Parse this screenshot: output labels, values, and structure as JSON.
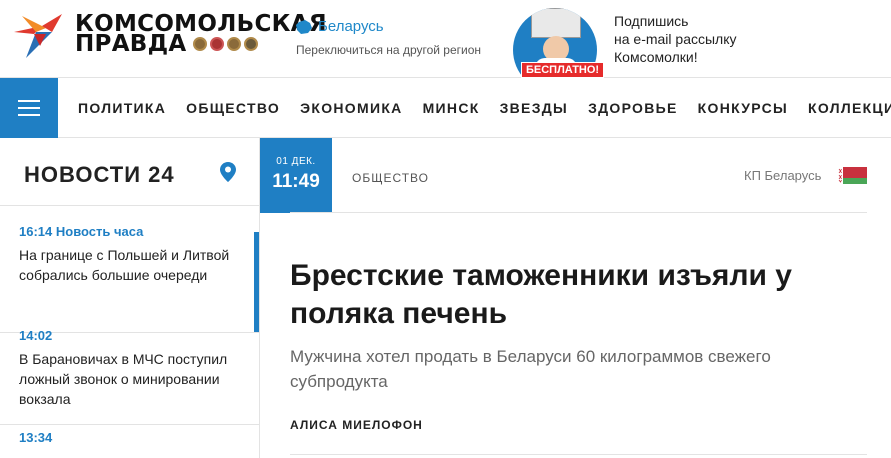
{
  "header": {
    "logo_line1": "КОМСОМОЛЬСКАЯ",
    "logo_line2": "ПРАВДА",
    "region": {
      "name": "Беларусь",
      "change_link": "Переключиться на другой регион"
    },
    "promo": {
      "badge": "БЕСПЛАТНО!",
      "line1": "Подпишись",
      "line2": "на e-mail рассылку",
      "line3": "Комсомолки!"
    }
  },
  "nav": {
    "items": [
      "ПОЛИТИКА",
      "ОБЩЕСТВО",
      "ЭКОНОМИКА",
      "МИНСК",
      "ЗВЕЗДЫ",
      "ЗДОРОВЬЕ",
      "КОНКУРСЫ",
      "КОЛЛЕКЦИИ"
    ]
  },
  "feed": {
    "title": "НОВОСТИ 24",
    "items": [
      {
        "time": "16:14 Новость часа",
        "text": "На границе с Польшей и Литвой собрались большие очереди"
      },
      {
        "time": "14:02",
        "text": "В Барановичах в МЧС поступил ложный звонок о минировании вокзала"
      },
      {
        "time": "13:34",
        "text": ""
      }
    ]
  },
  "article": {
    "date": "01 ДЕК.",
    "time": "11:49",
    "rubric": "ОБЩЕСТВО",
    "source": "КП Беларусь",
    "headline": "Брестские таможенники изъяли у поляка печень",
    "subheadline": "Мужчина хотел продать в Беларуси 60 килограммов свежего субпродукта",
    "author": "АЛИСА МИЕЛОФОН"
  },
  "colors": {
    "accent": "#1f7fc4",
    "promo_badge": "#e62b2b",
    "logo_red": "#e03a2f",
    "logo_orange": "#f28c28"
  }
}
